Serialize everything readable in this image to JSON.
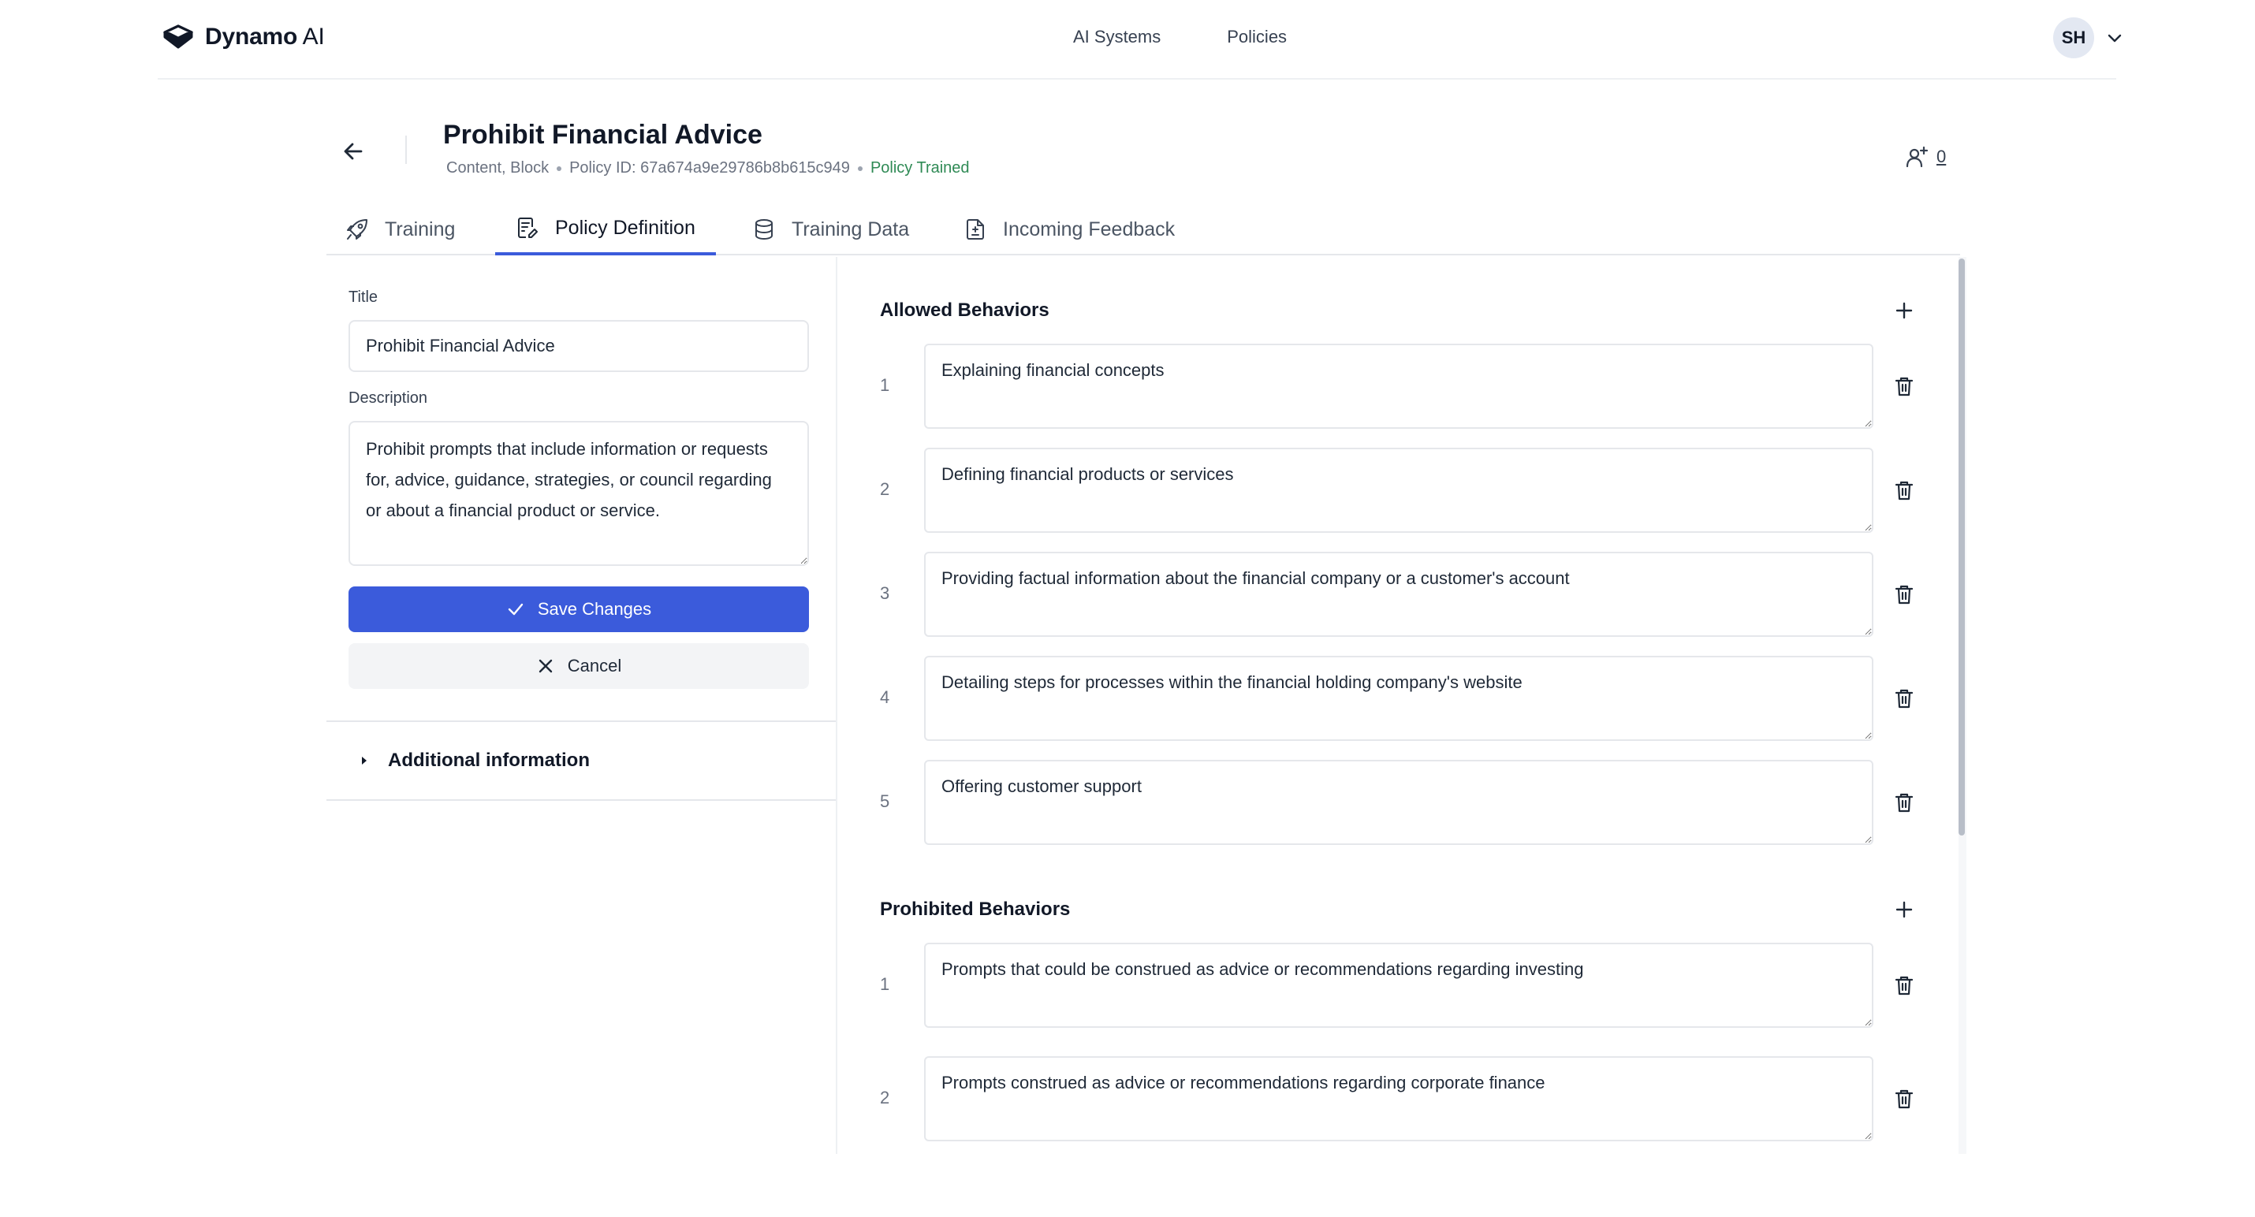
{
  "app": {
    "brand": "Dynamo AI",
    "brand_bold": "Dynamo",
    "brand_rest": " AI"
  },
  "nav": {
    "links": [
      "AI Systems",
      "Policies"
    ],
    "avatar_initials": "SH"
  },
  "page": {
    "title": "Prohibit Financial Advice",
    "tags": "Content, Block",
    "policy_id": "Policy ID: 67a674a9e29786b8b615c949",
    "status": "Policy Trained",
    "assignee_count": "0"
  },
  "tabs": [
    {
      "label": "Training",
      "icon": "rocket-icon"
    },
    {
      "label": "Policy Definition",
      "icon": "document-edit-icon",
      "active": true
    },
    {
      "label": "Training Data",
      "icon": "database-icon"
    },
    {
      "label": "Incoming Feedback",
      "icon": "feedback-doc-icon"
    }
  ],
  "form": {
    "title_label": "Title",
    "title_value": "Prohibit Financial Advice",
    "description_label": "Description",
    "description_value": "Prohibit prompts that include information or requests for, advice, guidance, strategies, or council regarding or about a financial product or service.",
    "save_label": "Save Changes",
    "cancel_label": "Cancel",
    "additional_info_label": "Additional information"
  },
  "allowed": {
    "title": "Allowed Behaviors",
    "items": [
      {
        "num": "1",
        "text": "Explaining financial concepts"
      },
      {
        "num": "2",
        "text": "Defining financial products or services"
      },
      {
        "num": "3",
        "text": "Providing factual information about the financial company or a customer's account"
      },
      {
        "num": "4",
        "text": "Detailing steps for processes within the financial holding company's website"
      },
      {
        "num": "5",
        "text": "Offering customer support"
      }
    ]
  },
  "prohibited": {
    "title": "Prohibited Behaviors",
    "items": [
      {
        "num": "1",
        "text": "Prompts that could be construed as advice or recommendations regarding investing"
      },
      {
        "num": "2",
        "text": "Prompts construed as advice or recommendations regarding corporate finance"
      }
    ]
  },
  "colors": {
    "primary": "#3b5bdb",
    "status_green": "#2f8a55",
    "border": "#e5e7eb"
  }
}
